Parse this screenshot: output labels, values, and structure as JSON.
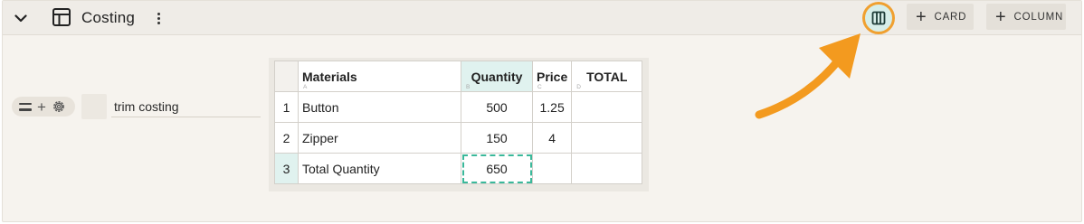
{
  "header": {
    "title": "Costing",
    "card_label": "CARD",
    "column_label": "COLUMN",
    "icons": [
      "chevron-down-icon",
      "table-layout-icon",
      "more-vertical-icon",
      "columns-icon",
      "plus-icon"
    ]
  },
  "row": {
    "name": "trim costing"
  },
  "sheet": {
    "columns": [
      {
        "label": "Materials",
        "letter": "A"
      },
      {
        "label": "Quantity",
        "letter": "B"
      },
      {
        "label": "Price",
        "letter": "C"
      },
      {
        "label": "TOTAL",
        "letter": "D"
      }
    ],
    "rows": [
      {
        "num": "1",
        "material": "Button",
        "quantity": "500",
        "price": "1.25",
        "total": ""
      },
      {
        "num": "2",
        "material": "Zipper",
        "quantity": "150",
        "price": "4",
        "total": ""
      },
      {
        "num": "3",
        "material": "Total Quantity",
        "quantity": "650",
        "price": "",
        "total": ""
      }
    ]
  },
  "colors": {
    "accent": "#3ab89a",
    "highlight_ring": "#f0a030",
    "arrow": "#f39a1f",
    "header_bg": "#efece7"
  }
}
